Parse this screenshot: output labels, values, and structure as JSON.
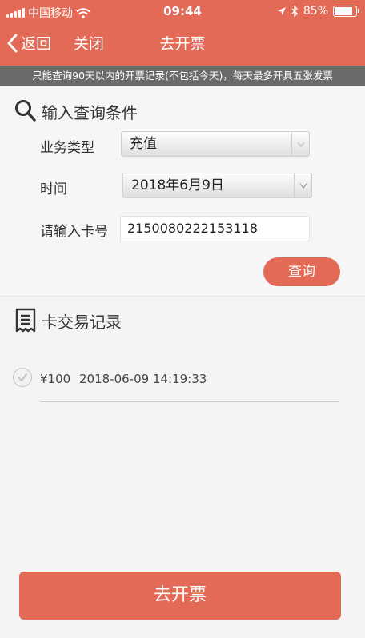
{
  "status_bar": {
    "carrier": "中国移动",
    "time": "09:44",
    "battery": "85%",
    "battery_level": 0.85
  },
  "nav": {
    "back_label": "返回",
    "close_label": "关闭",
    "title": "去开票"
  },
  "notice": "只能查询90天以内的开票记录(不包括今天)，每天最多开具五张发票",
  "query": {
    "title": "输入查询条件",
    "business_type_label": "业务类型",
    "business_type_value": "充值",
    "time_label": "时间",
    "time_value": "2018年6月9日",
    "card_label": "请输入卡号",
    "card_value": "2150080222153118",
    "query_button": "查询"
  },
  "records": {
    "title": "卡交易记录",
    "items": [
      {
        "amount": "¥100",
        "time": "2018-06-09 14:19:33"
      }
    ]
  },
  "submit_button": "去开票",
  "colors": {
    "brand": "#e26a56",
    "notice_bg": "#6a6a6a"
  }
}
